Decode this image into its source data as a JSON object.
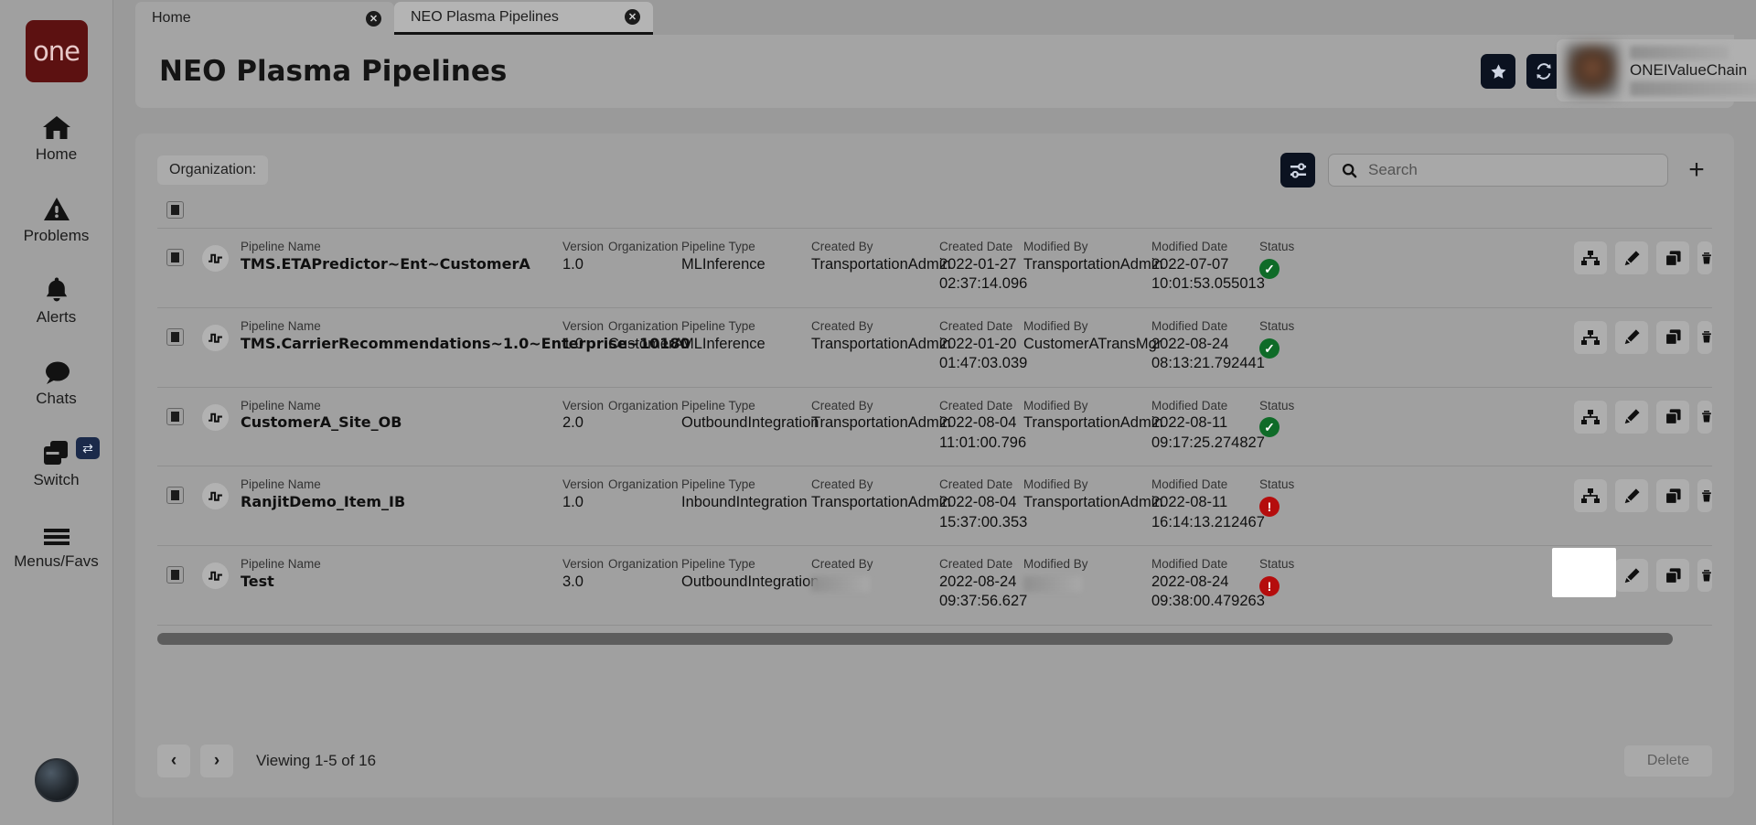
{
  "brand": {
    "logo_text": "one"
  },
  "sidebar": {
    "items": [
      {
        "label": "Home",
        "icon": "home-icon"
      },
      {
        "label": "Problems",
        "icon": "warning-triangle-icon"
      },
      {
        "label": "Alerts",
        "icon": "bell-icon"
      },
      {
        "label": "Chats",
        "icon": "chat-bubble-icon"
      },
      {
        "label": "Switch",
        "icon": "switch-windows-icon",
        "badge_icon": "swap-arrows-icon"
      },
      {
        "label": "Menus/Favs",
        "icon": "hamburger-icon"
      }
    ]
  },
  "tabs": [
    {
      "label": "Home",
      "active": false
    },
    {
      "label": "NEO Plasma Pipelines",
      "active": true
    }
  ],
  "header": {
    "title": "NEO Plasma Pipelines",
    "buttons": [
      {
        "name": "favorite-button",
        "icon": "star-icon"
      },
      {
        "name": "refresh-button",
        "icon": "refresh-icon"
      },
      {
        "name": "close-button",
        "icon": "close-x-icon"
      }
    ],
    "menu_button_icon": "hamburger-icon",
    "menu_badge_icon": "star-icon"
  },
  "user": {
    "name_redacted": true,
    "org": "ONEIValueChain",
    "role_redacted": true,
    "caret_icon": "chevron-down-icon"
  },
  "toolbar": {
    "organization_filter_label": "Organization:",
    "filter_button_icon": "sliders-icon",
    "search": {
      "placeholder": "Search",
      "value": "",
      "icon": "search-icon"
    },
    "add_button_label": "+"
  },
  "table": {
    "columns": {
      "name": "Pipeline Name",
      "version": "Version",
      "organization": "Organization",
      "type": "Pipeline Type",
      "created_by": "Created By",
      "created_date": "Created Date",
      "modified_by": "Modified By",
      "modified_date": "Modified Date",
      "status": "Status"
    },
    "row_actions": [
      {
        "name": "view-graph-button",
        "icon": "nodes-hierarchy-icon"
      },
      {
        "name": "edit-button",
        "icon": "pencil-icon"
      },
      {
        "name": "copy-button",
        "icon": "copy-icon"
      },
      {
        "name": "delete-button",
        "icon": "trash-icon"
      }
    ],
    "rows": [
      {
        "name": "TMS.ETAPredictor~Ent~CustomerA",
        "version": "1.0",
        "organization": "",
        "type": "MLInference",
        "created_by": "TransportationAdmin",
        "created_date": "2022-01-27",
        "created_time": "02:37:14.096",
        "modified_by": "TransportationAdmin",
        "modified_date": "2022-07-07",
        "modified_time": "10:01:53.055013",
        "status": "ok"
      },
      {
        "name": "TMS.CarrierRecommendations~1.0~Enterprise~10180",
        "version": "1.0",
        "organization": "CustomerA",
        "type": "MLInference",
        "created_by": "TransportationAdmin",
        "created_date": "2022-01-20",
        "created_time": "01:47:03.039",
        "modified_by": "CustomerATransMgr",
        "modified_date": "2022-08-24",
        "modified_time": "08:13:21.792441",
        "status": "ok"
      },
      {
        "name": "CustomerA_Site_OB",
        "version": "2.0",
        "organization": "",
        "type": "OutboundIntegration",
        "created_by": "TransportationAdmin",
        "created_date": "2022-08-04",
        "created_time": "11:01:00.796",
        "modified_by": "TransportationAdmin",
        "modified_date": "2022-08-11",
        "modified_time": "09:17:25.274827",
        "status": "ok"
      },
      {
        "name": "RanjitDemo_Item_IB",
        "version": "1.0",
        "organization": "",
        "type": "InboundIntegration",
        "created_by": "TransportationAdmin",
        "created_date": "2022-08-04",
        "created_time": "15:37:00.353",
        "modified_by": "TransportationAdmin",
        "modified_date": "2022-08-11",
        "modified_time": "16:14:13.212467",
        "status": "error"
      },
      {
        "name": "Test",
        "version": "3.0",
        "organization": "",
        "type": "OutboundIntegration",
        "created_by": "",
        "created_by_redacted": true,
        "created_date": "2022-08-24",
        "created_time": "09:37:56.627",
        "modified_by": "",
        "modified_by_redacted": true,
        "modified_date": "2022-08-24",
        "modified_time": "09:38:00.479263",
        "status": "error"
      }
    ]
  },
  "footer": {
    "prev_icon": "chevron-left-icon",
    "next_icon": "chevron-right-icon",
    "viewing_text": "Viewing 1-5 of 16",
    "delete_label": "Delete"
  },
  "colors": {
    "brand_maroon": "#5c1111",
    "status_ok": "#0f6b28",
    "status_error": "#b50d0d",
    "dark_button": "#0b1220"
  }
}
